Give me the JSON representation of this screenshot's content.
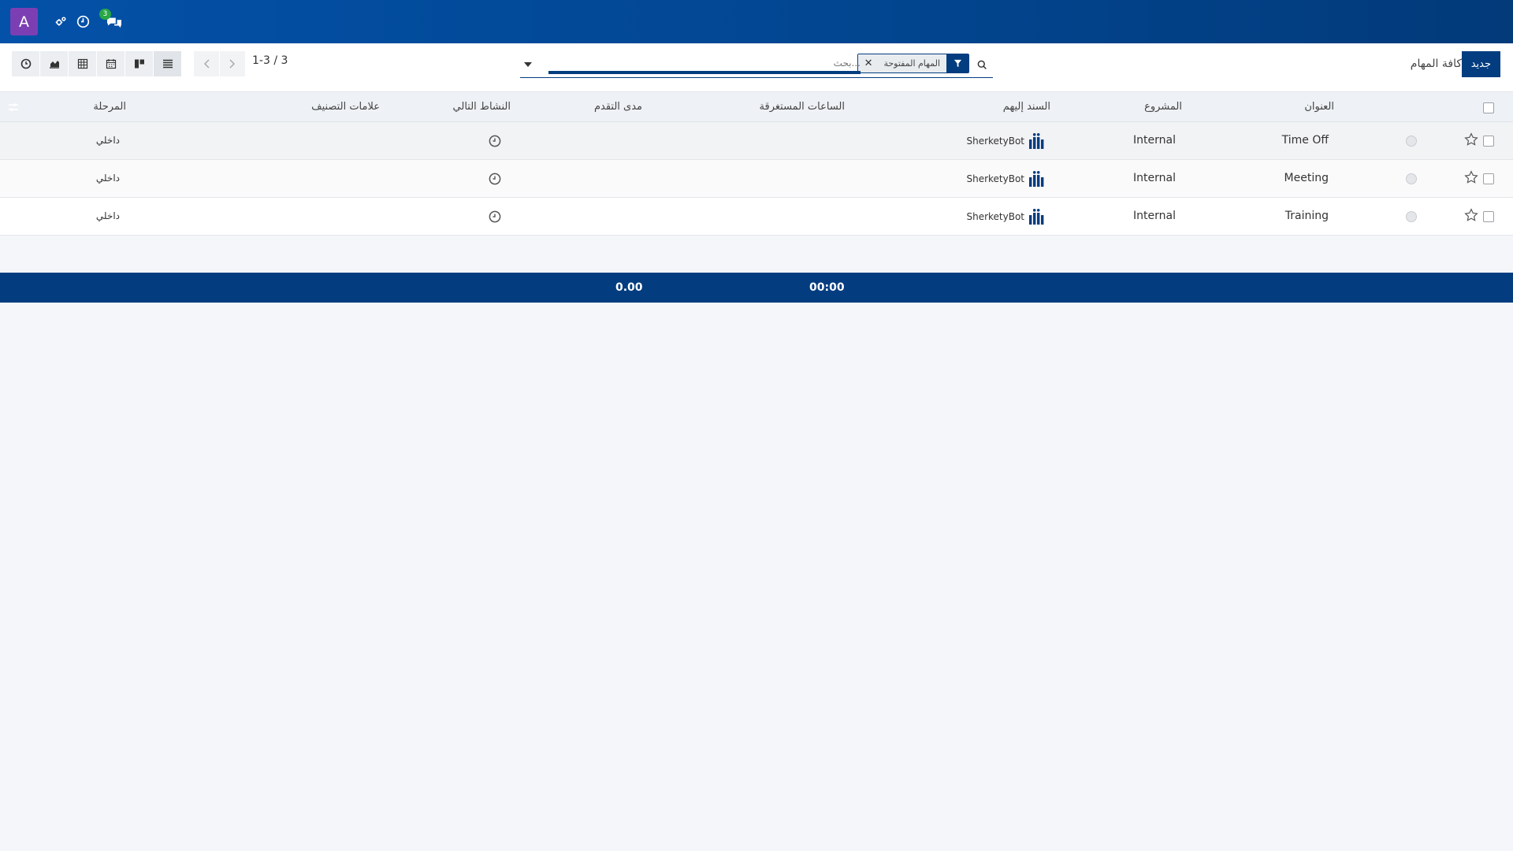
{
  "navbar": {
    "avatar_letter": "A",
    "icons": [
      "settings-icon",
      "clock-icon",
      "chat-icon"
    ],
    "chat_badge": "3"
  },
  "control": {
    "new_button": "جديد",
    "breadcrumb": "كافة المهام",
    "search": {
      "facet_label": "المهام المفتوحة",
      "placeholder": "بحث..."
    },
    "pager": "1-3 / 3",
    "views": [
      "list",
      "kanban",
      "calendar",
      "pivot",
      "graph",
      "activity"
    ]
  },
  "table": {
    "headers": {
      "title": "العنوان",
      "project": "المشروع",
      "assignee": "السند إليهم",
      "hours_spent": "الساعات المستغرقة",
      "progress": "مدى التقدم",
      "next_activity": "النشاط التالي",
      "tags": "علامات التصنيف",
      "stage": "المرحلة"
    },
    "rows": [
      {
        "title": "Time Off",
        "project": "Internal",
        "assignee": "SherketyBot",
        "stage": "داخلي"
      },
      {
        "title": "Meeting",
        "project": "Internal",
        "assignee": "SherketyBot",
        "stage": "داخلي"
      },
      {
        "title": "Training",
        "project": "Internal",
        "assignee": "SherketyBot",
        "stage": "داخلي"
      }
    ],
    "totals": {
      "hours_spent": "00:00",
      "progress": "0.00"
    }
  },
  "colors": {
    "brand": "#033d80",
    "navbar": "#0351a8",
    "avatar": "#7b3fb3",
    "badge": "#28a745"
  }
}
